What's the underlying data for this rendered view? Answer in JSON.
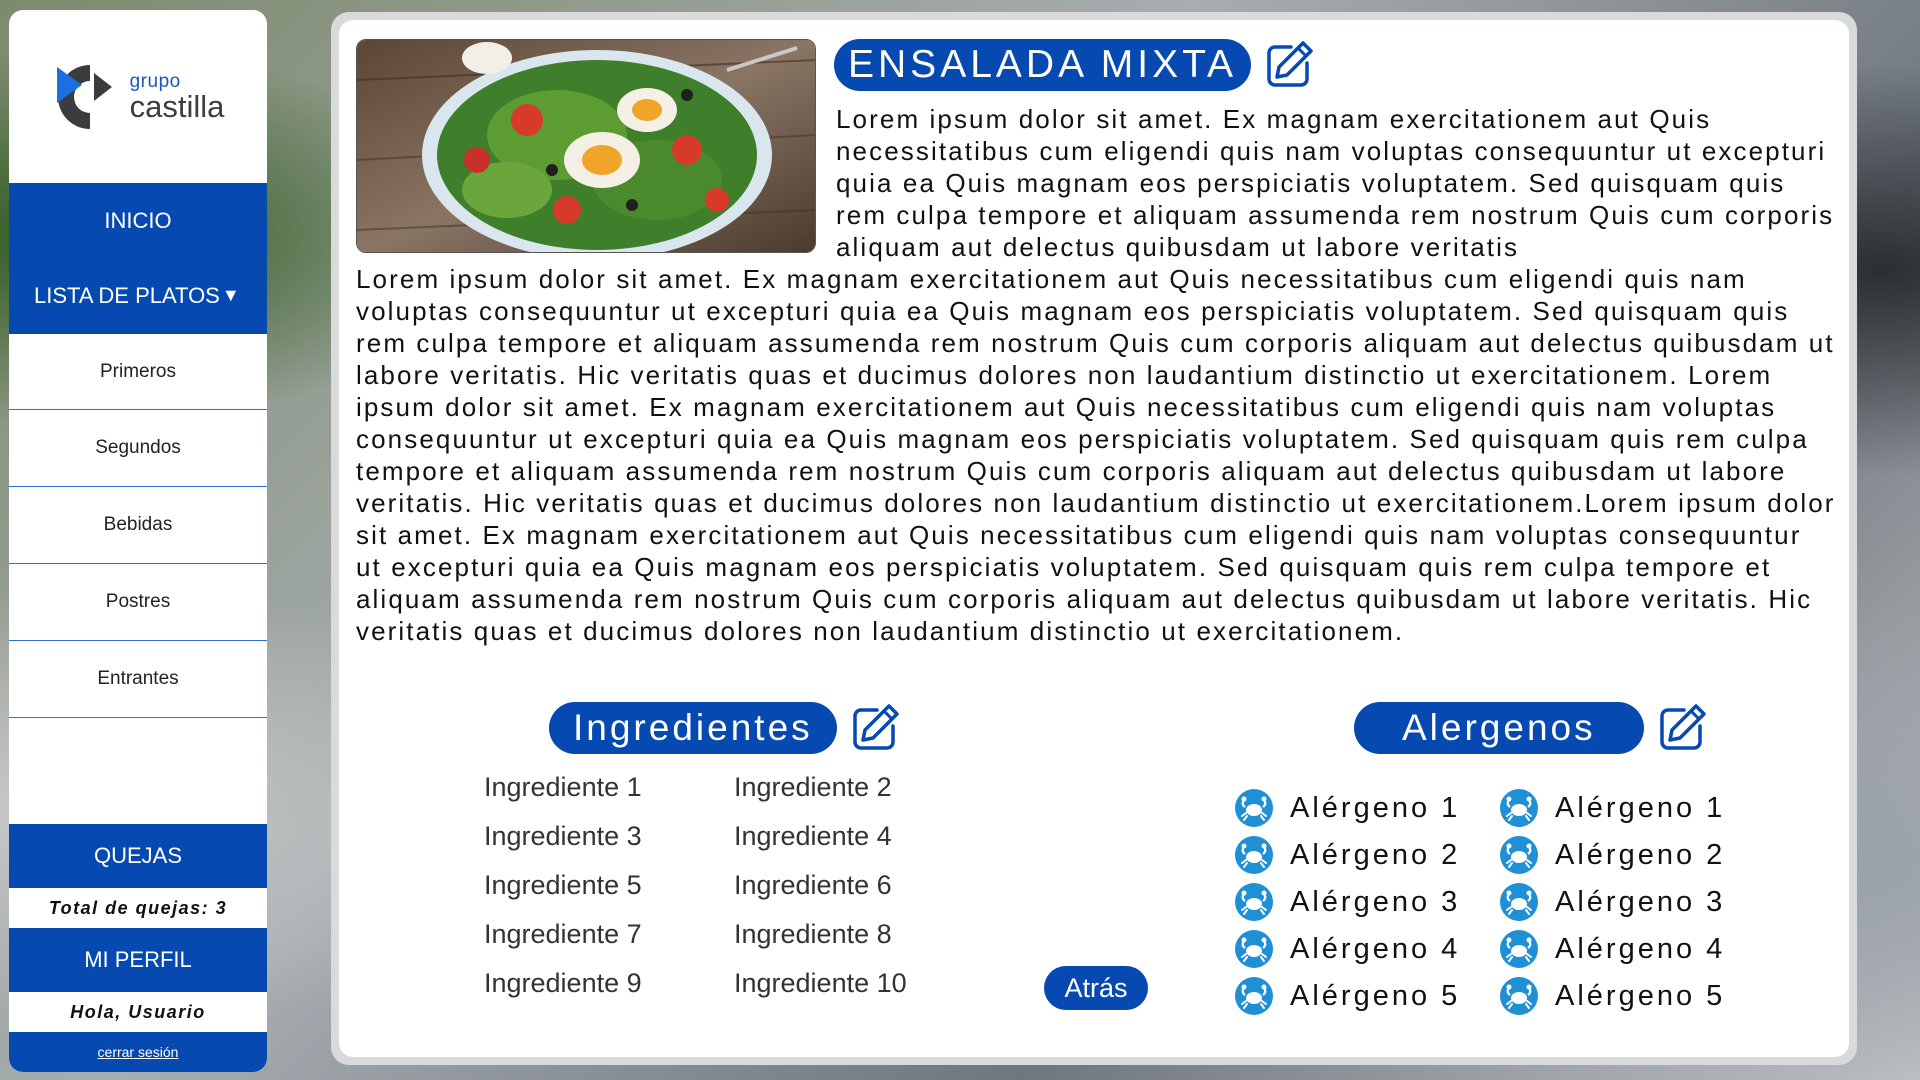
{
  "brand": {
    "small": "grupo",
    "big": "castilla"
  },
  "nav": {
    "inicio": "INICIO",
    "lista": "LISTA DE PLATOS",
    "lista_caret": "▼",
    "submenu": [
      "Primeros",
      "Segundos",
      "Bebidas",
      "Postres",
      "Entrantes"
    ],
    "quejas": "QUEJAS",
    "total_quejas": "Total de quejas: 3",
    "perfil": "MI PERFIL",
    "saludo": "Hola, Usuario",
    "cerrar": "cerrar sesión"
  },
  "dish": {
    "title": "ENSALADA MIXTA",
    "desc_top": "Lorem ipsum dolor sit amet. Ex magnam exercitationem aut Quis necessitatibus cum eligendi quis nam voluptas consequuntur ut excepturi quia ea Quis magnam eos perspiciatis voluptatem. Sed quisquam quis rem culpa tempore et aliquam assumenda rem nostrum Quis cum corporis aliquam aut delectus quibusdam ut labore veritatis",
    "desc_main": "Lorem ipsum dolor sit amet. Ex magnam exercitationem aut Quis necessitatibus cum eligendi quis nam voluptas consequuntur ut excepturi quia ea Quis magnam eos perspiciatis voluptatem. Sed quisquam quis rem culpa tempore et aliquam assumenda rem nostrum Quis cum corporis aliquam aut delectus quibusdam ut labore veritatis. Hic veritatis quas et ducimus dolores non laudantium distinctio ut exercitationem. Lorem ipsum dolor sit amet. Ex magnam exercitationem aut Quis necessitatibus cum eligendi quis nam voluptas consequuntur ut excepturi quia ea Quis magnam eos perspiciatis voluptatem. Sed quisquam quis rem culpa tempore et aliquam assumenda rem nostrum Quis cum corporis aliquam aut delectus quibusdam ut labore veritatis. Hic veritatis quas et ducimus dolores non laudantium distinctio ut exercitationem.Lorem ipsum dolor sit amet. Ex magnam exercitationem aut Quis necessitatibus cum eligendi quis nam voluptas consequuntur ut excepturi quia ea Quis magnam eos perspiciatis voluptatem. Sed quisquam quis rem culpa tempore et aliquam assumenda rem nostrum Quis cum corporis aliquam aut delectus quibusdam ut labore veritatis. Hic veritatis quas et ducimus dolores non laudantium distinctio ut exercitationem."
  },
  "ingredients": {
    "title": "Ingredientes",
    "items": [
      "Ingrediente 1",
      "Ingrediente 2",
      "Ingrediente 3",
      "Ingrediente 4",
      "Ingrediente 5",
      "Ingrediente 6",
      "Ingrediente 7",
      "Ingrediente 8",
      "Ingrediente 9",
      "Ingrediente 10"
    ]
  },
  "allergens": {
    "title": "Alergenos",
    "items": [
      "Alérgeno 1",
      "Alérgeno 1",
      "Alérgeno 2",
      "Alérgeno 2",
      "Alérgeno 3",
      "Alérgeno 3",
      "Alérgeno 4",
      "Alérgeno 4",
      "Alérgeno 5",
      "Alérgeno 5"
    ],
    "icon": "crab-icon"
  },
  "back": "Atrás",
  "colors": {
    "primary": "#0549b1",
    "allergen_icon": "#1f8fd6"
  }
}
